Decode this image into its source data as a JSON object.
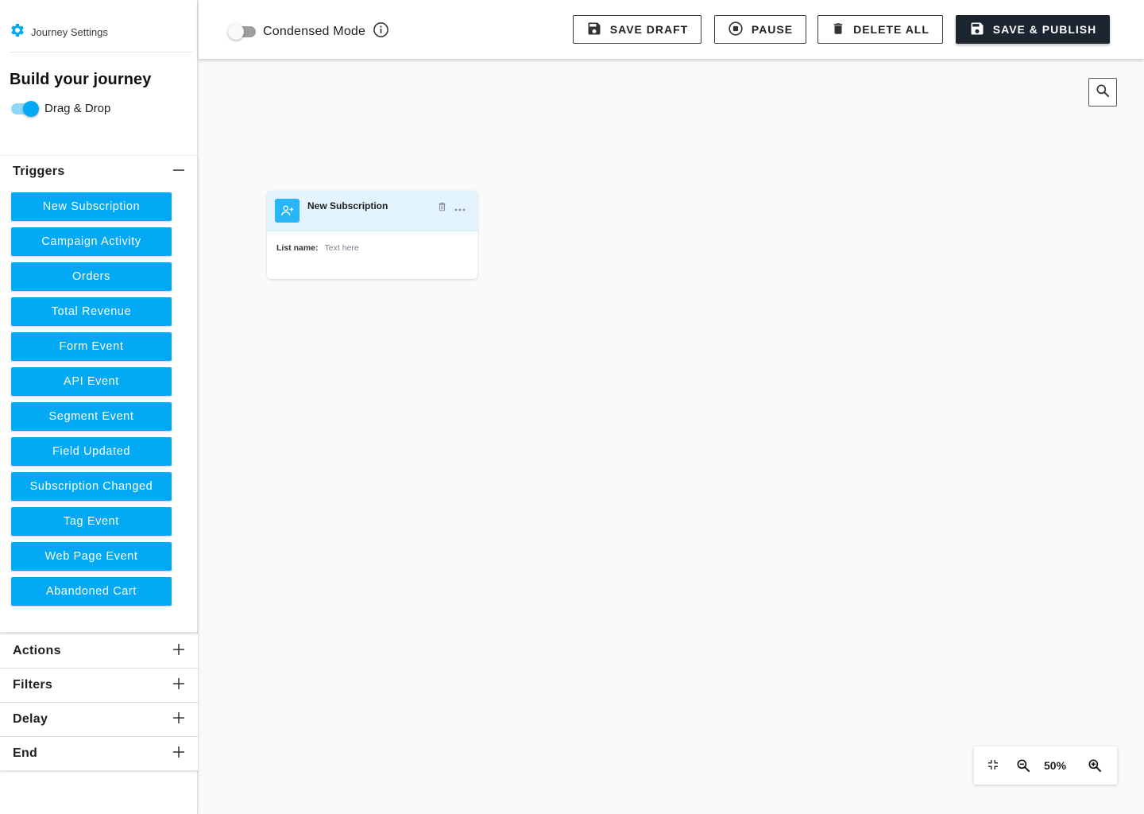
{
  "sidebar": {
    "settings_label": "Journey Settings",
    "build_title": "Build your journey",
    "drag_drop_label": "Drag & Drop",
    "drag_drop_enabled": true,
    "triggers": {
      "title": "Triggers",
      "toggle_icon": "minus-icon",
      "items": [
        "New Subscription",
        "Campaign Activity",
        "Orders",
        "Total Revenue",
        "Form Event",
        "API Event",
        "Segment Event",
        "Field Updated",
        "Subscription Changed",
        "Tag Event",
        "Web Page Event",
        "Abandoned Cart"
      ]
    },
    "sections": [
      {
        "title": "Actions",
        "icon": "plus-icon"
      },
      {
        "title": "Filters",
        "icon": "plus-icon"
      },
      {
        "title": "Delay",
        "icon": "plus-icon"
      },
      {
        "title": "End",
        "icon": "plus-icon"
      }
    ]
  },
  "topbar": {
    "condensed_label": "Condensed Mode",
    "condensed_enabled": false,
    "buttons": {
      "save_draft": "SAVE DRAFT",
      "pause": "PAUSE",
      "delete_all": "DELETE ALL",
      "save_publish": "SAVE & PUBLISH"
    }
  },
  "canvas": {
    "node": {
      "title": "New Subscription",
      "field_label": "List name:",
      "field_value": "Text here"
    },
    "zoom_level": "50%"
  },
  "colors": {
    "accent": "#03a9f4",
    "primary_dark": "#1c2430",
    "node_header": "#e3f4fd"
  }
}
